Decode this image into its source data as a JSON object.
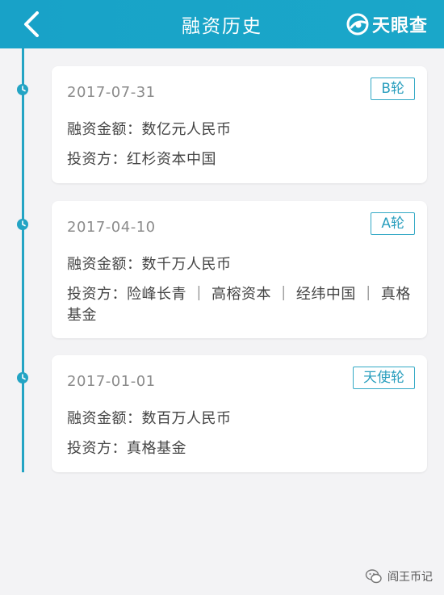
{
  "header": {
    "title": "融资历史",
    "brand_name": "天眼查",
    "back_icon": "chevron-left-icon",
    "brand_color": "#18a2c8"
  },
  "records": [
    {
      "date": "2017-07-31",
      "round": "B轮",
      "amount": "融资金额：数亿元人民币",
      "investors": "投资方：红杉资本中国"
    },
    {
      "date": "2017-04-10",
      "round": "A轮",
      "amount": "融资金额：数千万人民币",
      "investors": "投资方：险峰长青 ｜ 高榕资本 ｜ 经纬中国 ｜ 真格基金"
    },
    {
      "date": "2017-01-01",
      "round": "天使轮",
      "amount": "融资金额：数百万人民币",
      "investors": "投资方：真格基金"
    }
  ],
  "watermark": {
    "text": "阎王币记"
  },
  "colors": {
    "accent": "#23a4c4",
    "background": "#f3f3f5",
    "card": "#ffffff"
  }
}
